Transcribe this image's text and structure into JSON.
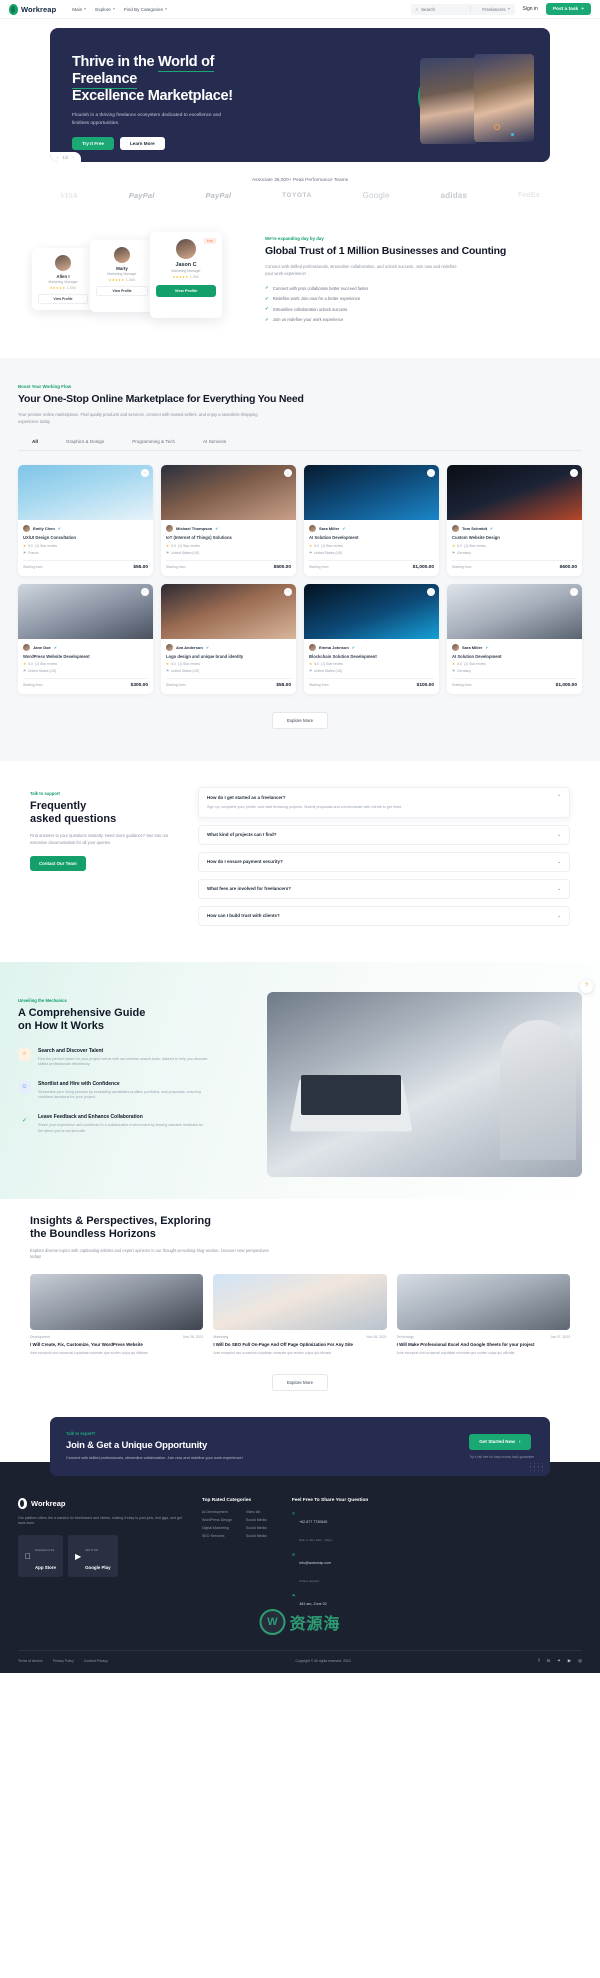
{
  "header": {
    "brand": "Workreap",
    "nav": [
      {
        "label": "Main",
        "caret": true
      },
      {
        "label": "Explore",
        "caret": true
      },
      {
        "label": "Find By Categories",
        "caret": true
      }
    ],
    "search": {
      "placeholder": "Search",
      "icon": "search-icon",
      "scope": "Freelancers"
    },
    "signin": "Sign in",
    "post_task": "Post a task",
    "post_task_icon": "+"
  },
  "hero": {
    "title_line1_a": "Thrive in the ",
    "title_line1_b": "World of Freelance",
    "title_line2": "Excellence Marketplace!",
    "subtitle": "Flourish in a thriving freelance ecosystem dedicated to excellence and limitless opportunities.",
    "btn_primary": "Try It Free",
    "btn_secondary": "Learn More",
    "pager_prev": "‹",
    "pager_label": "1/2",
    "pager_next": "›"
  },
  "brands": {
    "heading": "Associate 36,000+ Peak Performance Teams",
    "logos": [
      "VISA",
      "PayPal",
      "PayPal",
      "TOYOTA",
      "Google",
      "adidas",
      "FedEx"
    ]
  },
  "trust": {
    "eyebrow": "We're expanding day by day",
    "title": "Global Trust of 1 Million Businesses and Counting",
    "body": "Connect with skilled professionals, streamline collaboration, and unlock success. Join now and redefine your work experience!",
    "bullets": [
      "Connect with pros collaborate better succeed faster",
      "Redefine work Join now for a better experience",
      "Streamline collaboration unlock success",
      "Join us redefine your work experience"
    ],
    "cards": [
      {
        "name": "Allen I",
        "role": "Marketing Manager",
        "rating": "★★★★★",
        "reviews": "1,050",
        "cta": "View Profile",
        "badge": ""
      },
      {
        "name": "Marty",
        "role": "Marketing Manager",
        "rating": "★★★★★",
        "reviews": "1,050",
        "cta": "View Profile",
        "badge": ""
      },
      {
        "name": "Jason C",
        "role": "Marketing Manager",
        "rating": "★★★★★",
        "reviews": "1,050",
        "cta": "View Profile",
        "badge": "TOP"
      }
    ]
  },
  "market": {
    "eyebrow": "Boost Your Working Flow",
    "title": "Your One-Stop Online Marketplace for Everything You Need",
    "subtitle": "Your premier online marketplace. Find quality products and services, connect with trusted sellers, and enjoy a seamless shopping experience today.",
    "tabs": [
      {
        "label": "All",
        "active": true
      },
      {
        "label": "Graphics & Design",
        "active": false
      },
      {
        "label": "Programming & Tech",
        "active": false
      },
      {
        "label": "AI Services",
        "active": false
      }
    ],
    "explore_label": "Explore More",
    "price_label": "Starting from",
    "cards": [
      {
        "seller": "Emily Chen",
        "title": "UX/UI Design Consultation",
        "rating": "5.0",
        "reviews": "(1) Star review",
        "location": "France",
        "price": "$55.00"
      },
      {
        "seller": "Michael Thompson",
        "title": "IoT (Internet of Things) Solutions",
        "rating": "5.0",
        "reviews": "(1) Star review",
        "location": "United States (US)",
        "price": "$500.00"
      },
      {
        "seller": "Sara Miller",
        "title": "AI Solution Development",
        "rating": "5.0",
        "reviews": "(1) Star review",
        "location": "United States (US)",
        "price": "$1,000.00"
      },
      {
        "seller": "Tom Schmidt",
        "title": "Custom Website Design",
        "rating": "5.0",
        "reviews": "(1) Star review",
        "location": "Germany",
        "price": "$600.00"
      },
      {
        "seller": "Jane Doe",
        "title": "WordPress Website Development",
        "rating": "5.0",
        "reviews": "(1) Star review",
        "location": "United States (US)",
        "price": "$300.00"
      },
      {
        "seller": "Ava Anderson",
        "title": "Logo design and unique brand identity",
        "rating": "5.0",
        "reviews": "(1) Star review",
        "location": "United States (US)",
        "price": "$55.00"
      },
      {
        "seller": "Emma Johnson",
        "title": "Blockchain Solution Development",
        "rating": "5.0",
        "reviews": "(1) Star review",
        "location": "United States (US)",
        "price": "$100.00"
      },
      {
        "seller": "Sara Miller",
        "title": "AI Solution Development",
        "rating": "5.0",
        "reviews": "(1) Star review",
        "location": "Germany",
        "price": "$1,000.00"
      }
    ]
  },
  "faq": {
    "eyebrow": "Talk to support",
    "title_line1": "Frequently",
    "title_line2": "asked questions",
    "body": "Find answers to your questions instantly. Need more guidance? See into our extensive documentation for all your queries.",
    "button": "Contact Our Team",
    "items": [
      {
        "q": "How do I get started as a freelancer?",
        "a": "Sign up, complete your profile, and start browsing projects. Submit proposals and communicate with clients to get hired.",
        "open": true
      },
      {
        "q": "What kind of projects can I find?",
        "a": "",
        "open": false
      },
      {
        "q": "How do I ensure payment security?",
        "a": "",
        "open": false
      },
      {
        "q": "What fees are involved for freelancers?",
        "a": "",
        "open": false
      },
      {
        "q": "How can I build trust with clients?",
        "a": "",
        "open": false
      }
    ]
  },
  "guide": {
    "eyebrow": "Unveiling the Mechanics",
    "title_line1": "A Comprehensive Guide",
    "title_line2": "on How It Works",
    "help_icon": "?",
    "steps": [
      {
        "icon": "search-icon",
        "title": "Search and Discover Talent",
        "body": "Find the perfect match for your project needs with our intuitive search tools, tailored to help you discover skilled professionals effortlessly."
      },
      {
        "icon": "user-check-icon",
        "title": "Shortlist and Hire with Confidence",
        "body": "Streamline your hiring process by evaluating candidates profiles, portfolios, and proposals, ensuring confident decisions for your project."
      },
      {
        "icon": "thumbs-up-icon",
        "title": "Leave Feedback and Enhance Collaboration",
        "body": "Share your experience and contribute to a collaborative environment by leaving valuable feedback for the talent you've worked with."
      }
    ]
  },
  "blog": {
    "title_line1": "Insights & Perspectives, Exploring",
    "title_line2": "the Boundless Horizons",
    "subtitle": "Explore diverse topics with captivating articles and expert opinions in our thought-provoking blog section. Uncover new perspectives today!",
    "explore_label": "Explore More",
    "posts": [
      {
        "category": "Development",
        "date": "Nov 26, 2021",
        "title": "I Will Create, Fix, Customize, Your WordPress Website",
        "excerpt": "Ante excepturi sint occaecati cupiditate nonerate que sunten culpa qui officiate."
      },
      {
        "category": "Marketing",
        "date": "Nov 26, 2021",
        "title": "I Will Do SEO Full On-Page And Off Page Optimization For Any Site",
        "excerpt": "Ante excepturi sint occaecati cupiditate nonerate que sunten culpa qui officiate."
      },
      {
        "category": "Technology",
        "date": "Jan 07, 2023",
        "title": "I Will Make Professional Excel And Google Sheets for your project",
        "excerpt": "Ante excepturi sint occaecati cupiditate nonerate que sunten culpa qui officiate."
      }
    ]
  },
  "cta": {
    "eyebrow": "Talk to expert?",
    "title": "Join & Get a Unique Opportunity",
    "body": "Connect with skilled professionals, streamline collaboration. Join now and redefine your work experience!",
    "button": "Get Started Now",
    "button_icon": "›",
    "note": "Try it risk free for days money back guarantee"
  },
  "footer": {
    "brand": "Workreap",
    "description": "Our platform offers the a solution for freelancers and clients, making it easy to post jobs, find gigs, and get work done.",
    "stores": [
      {
        "icon": "apple-icon",
        "small": "Download on the",
        "big": "App Store"
      },
      {
        "icon": "google-play-icon",
        "small": "GET IT ON",
        "big": "Google Play"
      }
    ],
    "categories_title": "Top Rated Categories",
    "categories": [
      "Video Art",
      "Social Media",
      "Social Media",
      "Social Media",
      "AI Development",
      "WordPress Design",
      "Digital Marketing",
      "SEO Services"
    ],
    "contact_title": "Feel Free To Share Your Question",
    "contact": [
      {
        "icon": "phone-icon",
        "text": "+62 877 7730549",
        "sub": "Mon to Sun 9am - 10pm"
      },
      {
        "icon": "mail-icon",
        "text": "info@workreap.com",
        "sub": "Online support"
      },
      {
        "icon": "pin-icon",
        "text": "481 am, Zone 02",
        "sub": "United States"
      }
    ],
    "bottom_links": [
      "Terms of service",
      "Privacy Policy",
      "Content Privacy"
    ],
    "copyright": "Copyright © All rights reserved. 2024",
    "social": [
      "facebook-icon",
      "linkedin-icon",
      "twitter-icon",
      "youtube-icon",
      "instagram-icon"
    ]
  },
  "watermark": {
    "mark": "W",
    "text": "资源海"
  }
}
